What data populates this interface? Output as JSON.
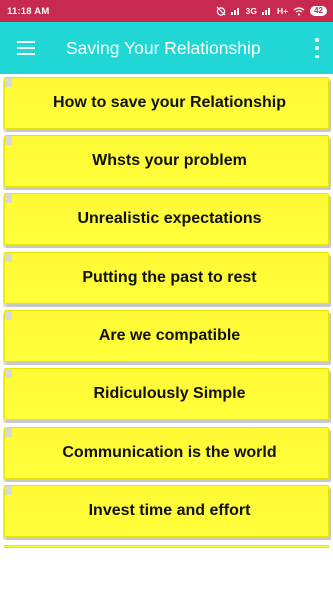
{
  "status_bar": {
    "time": "11:18 AM",
    "network_label": "3G",
    "network_label_2": "H+",
    "battery": "42"
  },
  "app_bar": {
    "title": "Saving Your Relationship"
  },
  "list": {
    "items": [
      {
        "label": "How to save your Relationship"
      },
      {
        "label": "Whsts your problem"
      },
      {
        "label": "Unrealistic expectations"
      },
      {
        "label": "Putting the past to rest"
      },
      {
        "label": "Are we compatible"
      },
      {
        "label": "Ridiculously Simple"
      },
      {
        "label": "Communication is the world"
      },
      {
        "label": "Invest time and effort"
      }
    ]
  },
  "colors": {
    "status_bar": "#c7294f",
    "app_bar": "#21d7d6",
    "item_background": "#ffff3a"
  }
}
